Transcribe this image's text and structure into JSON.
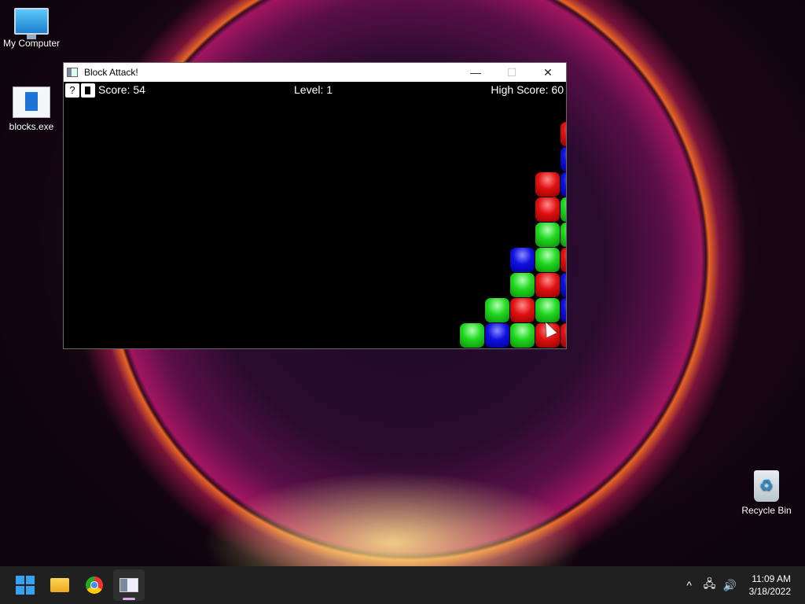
{
  "desktop": {
    "icons": [
      {
        "label": "My Computer"
      },
      {
        "label": "blocks.exe"
      },
      {
        "label": "Recycle Bin"
      }
    ]
  },
  "window": {
    "title": "Block Attack!",
    "minimize_glyph": "—",
    "maximize_glyph": "☐",
    "close_glyph": "✕"
  },
  "game": {
    "help_label": "?",
    "score_text": "Score: 54",
    "level_text": "Level: 1",
    "high_score_text": "High Score: 60",
    "colors": {
      "red": "#e01010",
      "green": "#20d820",
      "blue": "#1010e0"
    },
    "blocks": [
      {
        "col": 0,
        "row": 0,
        "color": "green"
      },
      {
        "col": 1,
        "row": 0,
        "color": "blue"
      },
      {
        "col": 2,
        "row": 0,
        "color": "green"
      },
      {
        "col": 3,
        "row": 0,
        "color": "red"
      },
      {
        "col": 4,
        "row": 0,
        "color": "red"
      },
      {
        "col": 1,
        "row": 1,
        "color": "green"
      },
      {
        "col": 2,
        "row": 1,
        "color": "red"
      },
      {
        "col": 3,
        "row": 1,
        "color": "green"
      },
      {
        "col": 4,
        "row": 1,
        "color": "blue"
      },
      {
        "col": 2,
        "row": 2,
        "color": "green"
      },
      {
        "col": 3,
        "row": 2,
        "color": "red"
      },
      {
        "col": 4,
        "row": 2,
        "color": "blue"
      },
      {
        "col": 2,
        "row": 3,
        "color": "blue"
      },
      {
        "col": 3,
        "row": 3,
        "color": "green"
      },
      {
        "col": 4,
        "row": 3,
        "color": "red"
      },
      {
        "col": 3,
        "row": 4,
        "color": "green"
      },
      {
        "col": 4,
        "row": 4,
        "color": "green"
      },
      {
        "col": 3,
        "row": 5,
        "color": "red"
      },
      {
        "col": 4,
        "row": 5,
        "color": "green"
      },
      {
        "col": 3,
        "row": 6,
        "color": "red"
      },
      {
        "col": 4,
        "row": 6,
        "color": "blue"
      },
      {
        "col": 4,
        "row": 7,
        "color": "blue"
      },
      {
        "col": 4,
        "row": 8,
        "color": "red"
      }
    ]
  },
  "taskbar": {
    "items": [
      "start-icon",
      "file-explorer-icon",
      "chrome-icon",
      "block-attack-icon"
    ],
    "tray": {
      "chevron": "^",
      "network_icon": "network-icon",
      "volume_icon": "volume-icon",
      "time": "11:09 AM",
      "date": "3/18/2022"
    }
  }
}
